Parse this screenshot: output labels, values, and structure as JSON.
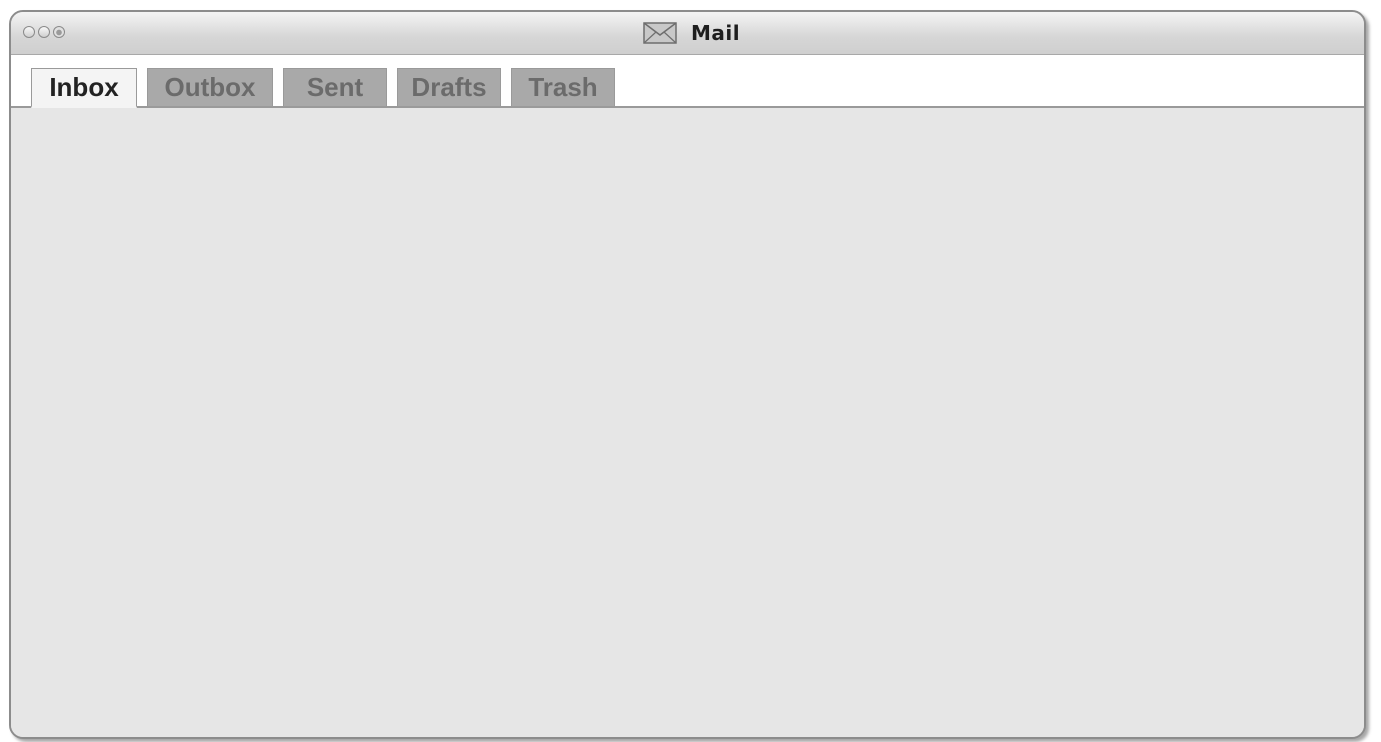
{
  "window": {
    "title": "Mail",
    "title_icon": "envelope-icon",
    "controls": [
      "close-button",
      "minimize-button",
      "zoom-button"
    ]
  },
  "tabs": [
    {
      "label": "Inbox",
      "active": true
    },
    {
      "label": "Outbox",
      "active": false
    },
    {
      "label": "Sent",
      "active": false
    },
    {
      "label": "Drafts",
      "active": false
    },
    {
      "label": "Trash",
      "active": false
    }
  ],
  "colors": {
    "content_background": "#e6e6e6",
    "inactive_tab": "#a9a9a9",
    "active_tab": "#f4f4f4"
  }
}
